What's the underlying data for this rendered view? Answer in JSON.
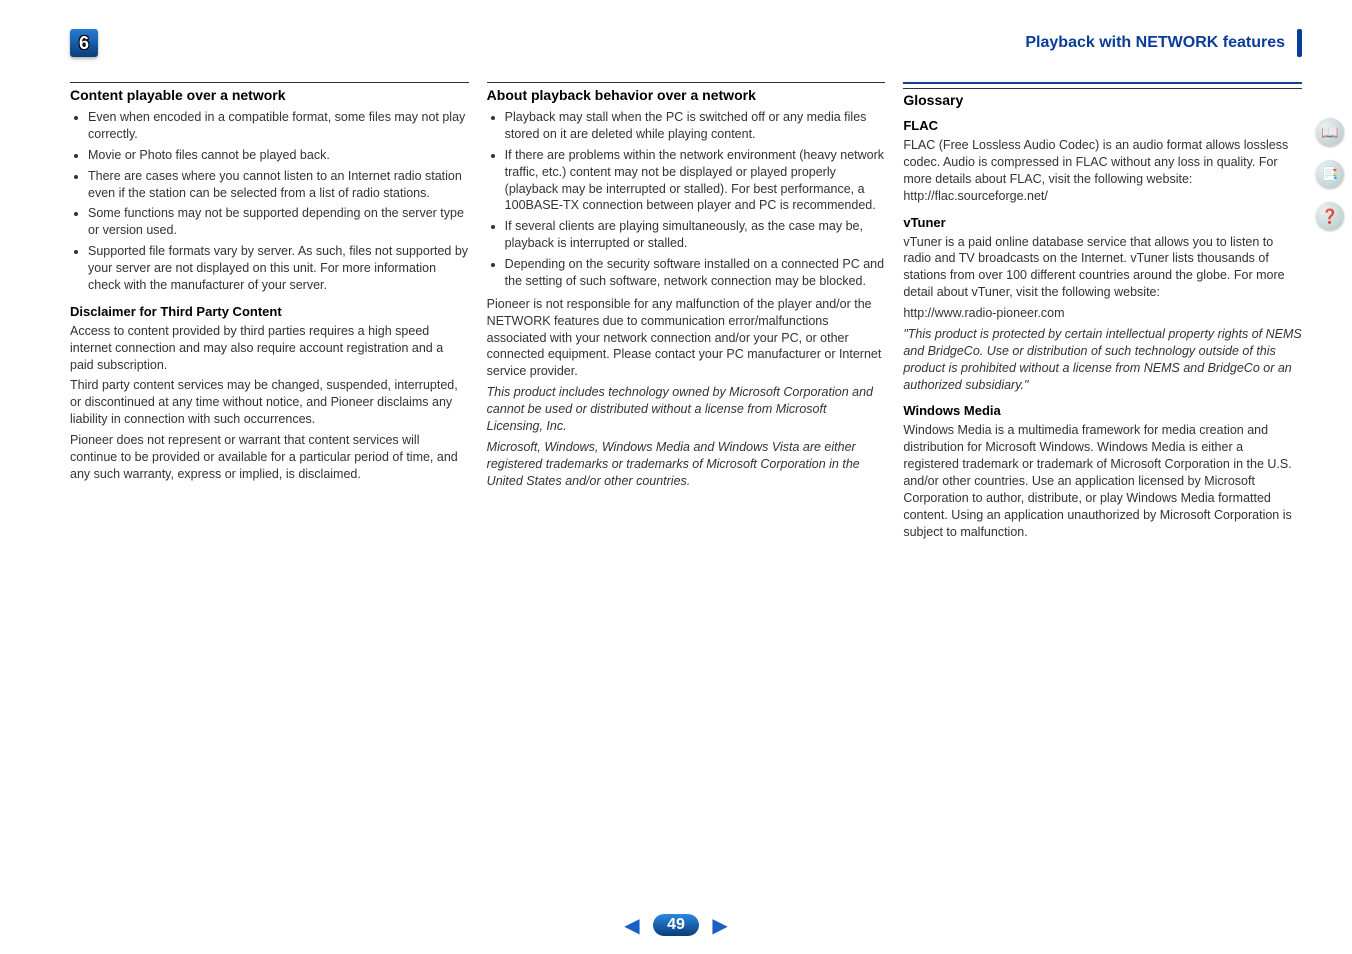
{
  "chapterNumber": "6",
  "headerTitle": "Playback with NETWORK features",
  "pageNumber": "49",
  "col1": {
    "h1": "Content playable over a network",
    "bullets": [
      "Even when encoded in a compatible format, some files may not play correctly.",
      "Movie or Photo files cannot be played back.",
      "There are cases where you cannot listen to an Internet radio station even if the station can be selected from a list of radio stations.",
      "Some functions may not be supported depending on the server type or version used.",
      "Supported file formats vary by server. As such, files not supported by your server are not displayed on this unit. For more information check with the manufacturer of your server."
    ],
    "disclaimerHeading": "Disclaimer for Third Party Content",
    "disclaimerP1": "Access to content provided by third parties requires a high speed internet connection and may also require account registration and a paid subscription.",
    "disclaimerP2": "Third party content services may be changed, suspended, interrupted, or discontinued at any time without notice, and Pioneer disclaims any liability in connection with such occurrences.",
    "disclaimerP3": "Pioneer does not represent or warrant that content services will continue to be provided or available for a particular period of time, and any such warranty, express or implied, is disclaimed."
  },
  "col2": {
    "h1": "About playback behavior over a network",
    "bullets": [
      "Playback may stall when the PC is switched off or any media files stored on it are deleted while playing content.",
      "If there are problems within the network environment (heavy network traffic, etc.) content may not be displayed or played properly (playback may be interrupted or stalled). For best performance, a 100BASE-TX connection between player and PC is recommended.",
      "If several clients are playing simultaneously, as the case may be, playback is interrupted or stalled.",
      "Depending on the security software installed on a connected PC and the setting of such software, network connection may be blocked."
    ],
    "p1": "Pioneer is not responsible for any malfunction of the player and/or the NETWORK features due to communication error/malfunctions associated with your network connection and/or your PC, or other connected equipment. Please contact your PC manufacturer or Internet service provider.",
    "italic1": "This product includes technology owned by Microsoft Corporation and cannot be used or distributed without a license from Microsoft Licensing, Inc.",
    "italic2": "Microsoft, Windows, Windows Media and Windows Vista are either registered trademarks or trademarks of Microsoft Corporation in the United States and/or other countries."
  },
  "col3": {
    "h1": "Glossary",
    "flacHeading": "FLAC",
    "flacBody": "FLAC (Free Lossless Audio Codec) is an audio format allows lossless codec. Audio is compressed in FLAC without any loss in quality. For more details about FLAC, visit the following website: http://flac.sourceforge.net/",
    "vtunerHeading": "vTuner",
    "vtunerBody": "vTuner is a paid online database service that allows you to listen to radio and TV broadcasts on the Internet. vTuner lists thousands of stations from over 100 different countries around the globe. For more detail about vTuner, visit the following website:",
    "vtunerUrl": "http://www.radio-pioneer.com",
    "vtunerItalic": "\"This product is protected by certain intellectual property rights of NEMS and BridgeCo. Use or distribution of such technology outside of this product is prohibited without a license from NEMS and BridgeCo or an authorized subsidiary.\"",
    "wmHeading": "Windows Media",
    "wmBody": "Windows Media is a multimedia framework for media creation and distribution for Microsoft Windows. Windows Media is either a registered trademark or trademark of Microsoft Corporation in the U.S. and/or other countries. Use an application licensed by Microsoft Corporation to author, distribute, or play Windows Media formatted content. Using an application unauthorized by Microsoft Corporation is subject to malfunction."
  },
  "sideIcons": {
    "book": "📖",
    "checklist": "📑",
    "help": "❓"
  },
  "nav": {
    "prev": "◀",
    "next": "▶"
  }
}
